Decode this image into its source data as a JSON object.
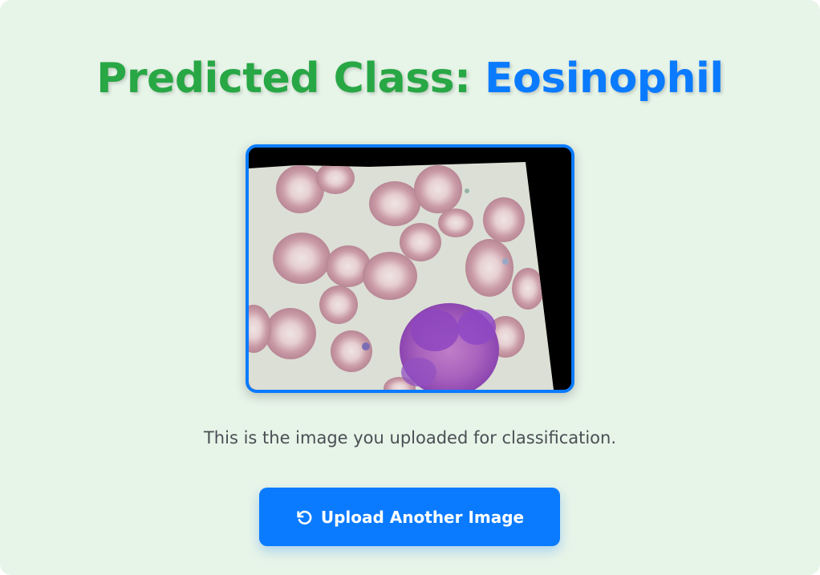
{
  "result": {
    "title_prefix": "Predicted Class: ",
    "predicted_class": "Eosinophil",
    "prefix_color": "#28a745",
    "class_color": "#0a7bff"
  },
  "preview": {
    "caption": "This is the image you uploaded for classification."
  },
  "actions": {
    "upload_another_label": "Upload Another Image",
    "upload_icon": "undo-icon"
  },
  "colors": {
    "background": "#e7f4e8",
    "accent": "#0a7bff"
  }
}
